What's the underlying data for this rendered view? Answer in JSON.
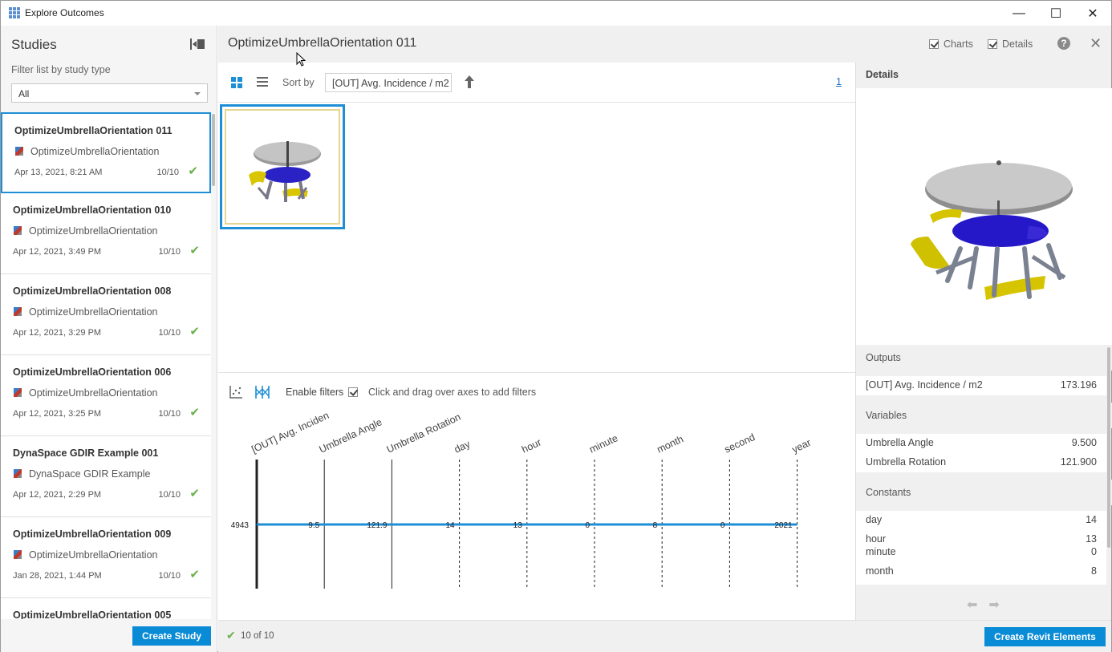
{
  "window": {
    "title": "Explore Outcomes",
    "minimize": "—",
    "maximize": "☐",
    "close": "✕"
  },
  "sidebar": {
    "title": "Studies",
    "filter_label": "Filter list by study type",
    "filter_value": "All",
    "studies": [
      {
        "name": "OptimizeUmbrellaOrientation 011",
        "type": "OptimizeUmbrellaOrientation",
        "date": "Apr 13, 2021, 8:21 AM",
        "count": "10/10",
        "selected": true
      },
      {
        "name": "OptimizeUmbrellaOrientation 010",
        "type": "OptimizeUmbrellaOrientation",
        "date": "Apr 12, 2021, 3:49 PM",
        "count": "10/10"
      },
      {
        "name": "OptimizeUmbrellaOrientation 008",
        "type": "OptimizeUmbrellaOrientation",
        "date": "Apr 12, 2021, 3:29 PM",
        "count": "10/10"
      },
      {
        "name": "OptimizeUmbrellaOrientation 006",
        "type": "OptimizeUmbrellaOrientation",
        "date": "Apr 12, 2021, 3:25 PM",
        "count": "10/10"
      },
      {
        "name": "DynaSpace GDIR Example 001",
        "type": "DynaSpace GDIR Example",
        "date": "Apr 12, 2021, 2:29 PM",
        "count": "10/10"
      },
      {
        "name": "OptimizeUmbrellaOrientation 009",
        "type": "OptimizeUmbrellaOrientation",
        "date": "Jan 28, 2021, 1:44 PM",
        "count": "10/10"
      },
      {
        "name": "OptimizeUmbrellaOrientation 005",
        "type": "",
        "date": "",
        "count": ""
      }
    ],
    "create_button": "Create Study"
  },
  "header": {
    "title": "OptimizeUmbrellaOrientation 011",
    "charts_label": "Charts",
    "details_label": "Details",
    "help": "?",
    "close": "✕"
  },
  "toolbar": {
    "sort_label": "Sort by",
    "sort_value": "[OUT] Avg. Incidence / m2",
    "page": "1"
  },
  "chart": {
    "enable_filters": "Enable filters",
    "hint": "Click and drag over axes to add filters"
  },
  "chart_data": {
    "type": "parallel-coordinates",
    "axes": [
      "[OUT] Avg. Incidence / m2",
      "Umbrella Angle",
      "Umbrella Rotation",
      "day",
      "hour",
      "minute",
      "month",
      "second",
      "year"
    ],
    "axis_display": [
      "[OUT] Avg. Inciden",
      "Umbrella Angle",
      "Umbrella Rotation",
      "day",
      "hour",
      "minute",
      "month",
      "second",
      "year"
    ],
    "values": [
      "4943",
      "9.5",
      "121.9",
      "14",
      "13",
      "0",
      "8",
      "0",
      "2021"
    ],
    "line_color": "#1e8fd6"
  },
  "status": {
    "text": "10 of 10",
    "create_button": "Create Revit Elements"
  },
  "details": {
    "title": "Details",
    "outputs_label": "Outputs",
    "outputs": [
      {
        "k": "[OUT] Avg. Incidence / m2",
        "v": "173.196"
      }
    ],
    "variables_label": "Variables",
    "variables": [
      {
        "k": "Umbrella Angle",
        "v": "9.500"
      },
      {
        "k": "Umbrella Rotation",
        "v": "121.900"
      }
    ],
    "constants_label": "Constants",
    "constants": [
      {
        "k": "day",
        "v": "14"
      },
      {
        "k": "hour",
        "v": "13"
      },
      {
        "k": "minute",
        "v": "0"
      },
      {
        "k": "month",
        "v": "8"
      }
    ]
  }
}
